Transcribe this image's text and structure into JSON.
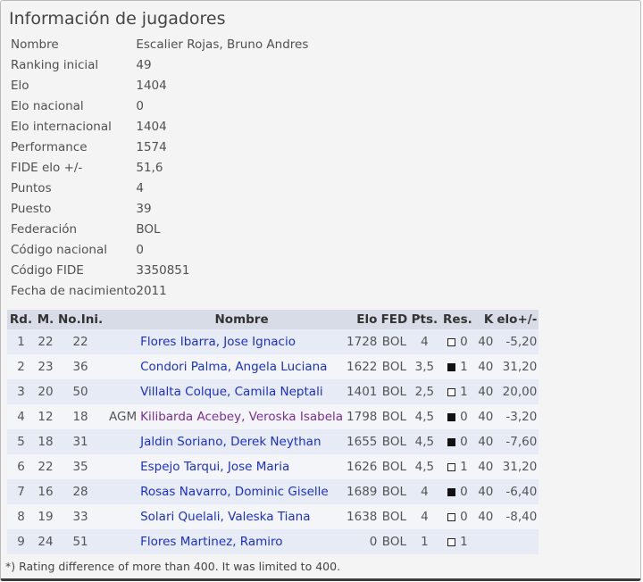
{
  "title": "Información de jugadores",
  "info": [
    {
      "label": "Nombre",
      "value": "Escalier Rojas, Bruno Andres"
    },
    {
      "label": "Ranking inicial",
      "value": "49"
    },
    {
      "label": "Elo",
      "value": "1404"
    },
    {
      "label": "Elo nacional",
      "value": "0"
    },
    {
      "label": "Elo internacional",
      "value": "1404"
    },
    {
      "label": "Performance",
      "value": "1574"
    },
    {
      "label": "FIDE elo +/-",
      "value": "51,6"
    },
    {
      "label": "Puntos",
      "value": "4"
    },
    {
      "label": "Puesto",
      "value": "39"
    },
    {
      "label": "Federación",
      "value": "BOL"
    },
    {
      "label": "Código nacional",
      "value": "0"
    },
    {
      "label": "Código FIDE",
      "value": "3350851"
    },
    {
      "label": "Fecha de nacimiento",
      "value": "2011"
    }
  ],
  "table": {
    "headers": {
      "rd": "Rd.",
      "m": "M.",
      "no": "No.Ini.",
      "title": "",
      "name": "Nombre",
      "elo": "Elo",
      "fed": "FED",
      "pts": "Pts.",
      "res": "Res.",
      "k": "K",
      "diff": "elo+/-"
    },
    "rows": [
      {
        "rd": "1",
        "m": "22",
        "no": "22",
        "title": "",
        "name": "Flores Ibarra, Jose Ignacio",
        "elo": "1728",
        "fed": "BOL",
        "pts": "4",
        "color": "white",
        "res": "0",
        "k": "40",
        "diff": "-5,20"
      },
      {
        "rd": "2",
        "m": "23",
        "no": "36",
        "title": "",
        "name": "Condori Palma, Angela Luciana",
        "elo": "1622",
        "fed": "BOL",
        "pts": "3,5",
        "color": "black",
        "res": "1",
        "k": "40",
        "diff": "31,20"
      },
      {
        "rd": "3",
        "m": "20",
        "no": "50",
        "title": "",
        "name": "Villalta Colque, Camila Neptali",
        "elo": "1401",
        "fed": "BOL",
        "pts": "2,5",
        "color": "white",
        "res": "1",
        "k": "40",
        "diff": "20,00"
      },
      {
        "rd": "4",
        "m": "12",
        "no": "18",
        "title": "AGM",
        "name": "Kilibarda Acebey, Veroska Isabela",
        "elo": "1798",
        "fed": "BOL",
        "pts": "4,5",
        "color": "black",
        "res": "0",
        "k": "40",
        "diff": "-3,20"
      },
      {
        "rd": "5",
        "m": "18",
        "no": "31",
        "title": "",
        "name": "Jaldin Soriano, Derek Neythan",
        "elo": "1655",
        "fed": "BOL",
        "pts": "4,5",
        "color": "black",
        "res": "0",
        "k": "40",
        "diff": "-7,60"
      },
      {
        "rd": "6",
        "m": "22",
        "no": "35",
        "title": "",
        "name": "Espejo Tarqui, Jose Maria",
        "elo": "1626",
        "fed": "BOL",
        "pts": "4,5",
        "color": "white",
        "res": "1",
        "k": "40",
        "diff": "31,20"
      },
      {
        "rd": "7",
        "m": "16",
        "no": "28",
        "title": "",
        "name": "Rosas Navarro, Dominic Giselle",
        "elo": "1689",
        "fed": "BOL",
        "pts": "4",
        "color": "black",
        "res": "0",
        "k": "40",
        "diff": "-6,40"
      },
      {
        "rd": "8",
        "m": "19",
        "no": "33",
        "title": "",
        "name": "Solari Quelali, Valeska Tiana",
        "elo": "1638",
        "fed": "BOL",
        "pts": "4",
        "color": "white",
        "res": "0",
        "k": "40",
        "diff": "-8,40"
      },
      {
        "rd": "9",
        "m": "24",
        "no": "51",
        "title": "",
        "name": "Flores Martinez, Ramiro",
        "elo": "0",
        "fed": "BOL",
        "pts": "1",
        "color": "white",
        "res": "1",
        "k": "",
        "diff": ""
      }
    ]
  },
  "footnote": "*) Rating difference of more than 400. It was limited to 400.",
  "colors": {
    "panel_bg": "#f4f4f4",
    "header_bg": "#d8dce6",
    "row_odd": "#e6ebf5",
    "row_even": "#f4f5f9",
    "link": "#1a2fd0",
    "titled_link": "#7a2d96"
  }
}
